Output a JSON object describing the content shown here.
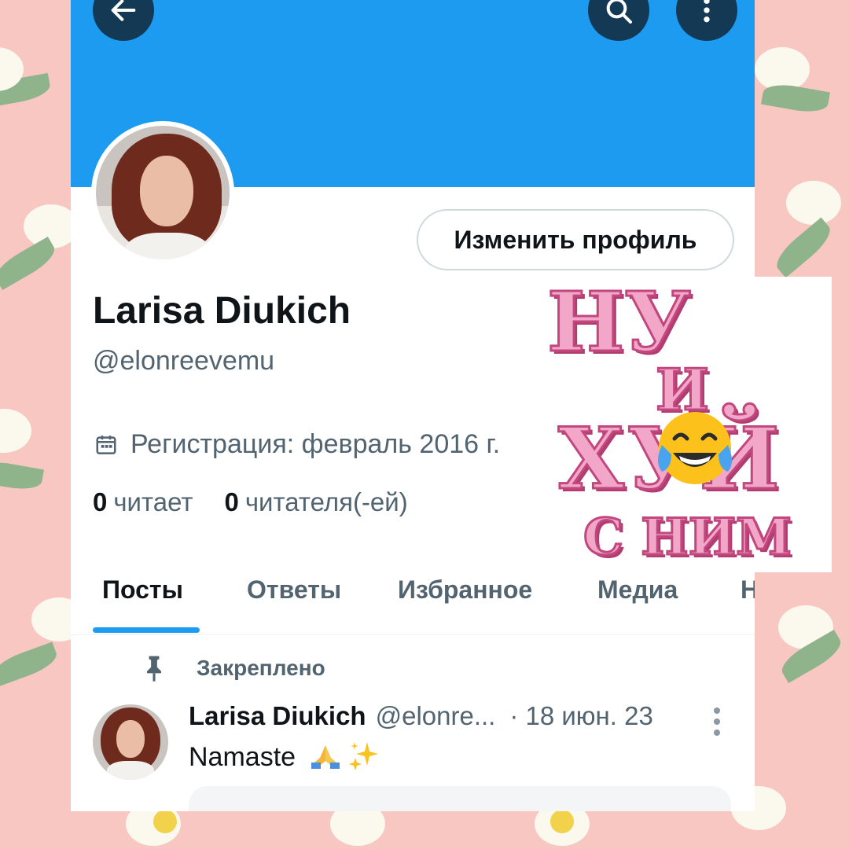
{
  "profile": {
    "display_name": "Larisa Diukich",
    "handle": "@elonreevemu",
    "edit_profile_label": "Изменить профиль",
    "joined": "Регистрация: февраль 2016 г.",
    "following_count": "0",
    "following_label": "читает",
    "followers_count": "0",
    "followers_label": "читателя(-ей)"
  },
  "tabs": [
    {
      "label": "Посты",
      "active": true
    },
    {
      "label": "Ответы",
      "active": false
    },
    {
      "label": "Избранное",
      "active": false
    },
    {
      "label": "Медиа",
      "active": false
    },
    {
      "label": "Н",
      "active": false
    }
  ],
  "pinned_post": {
    "pinned_label": "Закреплено",
    "author_name": "Larisa Diukich",
    "author_handle": "@elonre...",
    "date": "· 18 июн. 23",
    "text": "Namaste",
    "emojis": [
      "folded-hands",
      "sparkles"
    ]
  },
  "sticker": {
    "line1": "НУ",
    "line2": "И",
    "line3": "ХУЙ",
    "line4": "С НИМ",
    "emoji": "face-with-tears-of-joy"
  },
  "icons": {
    "back": "back-arrow-icon",
    "search": "search-icon",
    "more": "more-vertical-icon",
    "calendar": "calendar-icon",
    "pin": "pin-icon"
  },
  "colors": {
    "banner": "#1d9bf0",
    "accent": "#1d9bf0",
    "text_primary": "#0f1419",
    "text_secondary": "#536471",
    "background": "#f8c7c2"
  }
}
